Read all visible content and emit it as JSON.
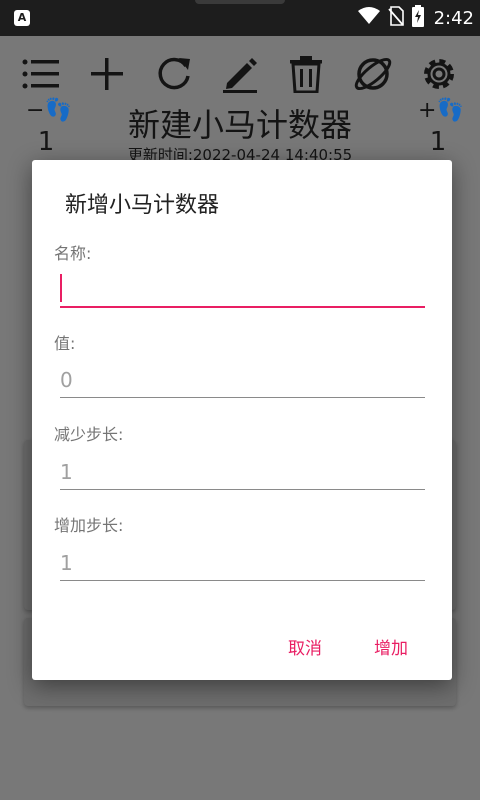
{
  "status_bar": {
    "app_icon_letter": "A",
    "time": "2:42",
    "icons": [
      "wifi-icon",
      "no-sim-icon",
      "battery-charging-icon"
    ]
  },
  "toolbar": {
    "buttons": [
      "menu-icon",
      "add-icon",
      "refresh-icon",
      "edit-icon",
      "delete-icon",
      "planet-icon",
      "settings-icon"
    ]
  },
  "counter": {
    "title": "新建小马计数器",
    "updated_label": "更新时间:",
    "updated_value": "2022-04-24 14:40:55",
    "decrement_symbol": "−",
    "decrement_value": "1",
    "increment_symbol": "+",
    "increment_value": "1"
  },
  "dialog": {
    "title": "新增小马计数器",
    "fields": [
      {
        "label": "名称:",
        "value": ""
      },
      {
        "label": "值:",
        "value": "0"
      },
      {
        "label": "减少步长:",
        "value": "1"
      },
      {
        "label": "增加步长:",
        "value": "1"
      }
    ],
    "cancel_label": "取消",
    "confirm_label": "增加"
  },
  "colors": {
    "accent": "#e91e63",
    "status_bar": "#1d1d1d",
    "scrim_bg": "#787878"
  }
}
